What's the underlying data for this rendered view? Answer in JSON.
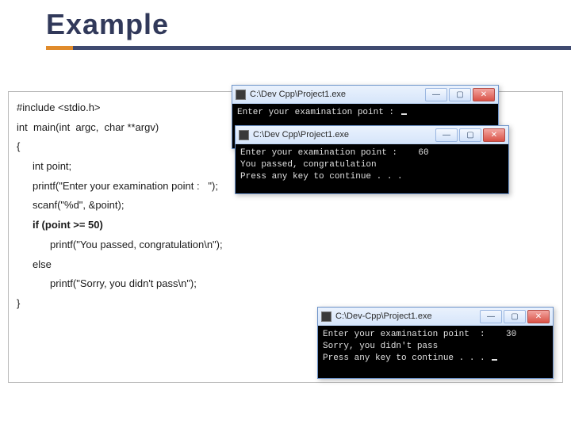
{
  "title": "Example",
  "code": {
    "l1": "#include <stdio.h>",
    "l2": "int  main(int  argc,  char **argv)",
    "l3": "{",
    "l4": "int point;",
    "l5": "printf(\"Enter your examination point :   \");",
    "l6": "scanf(\"%d\", &point);",
    "l7a": "if (",
    "l7b": "point >= 50)",
    "l8": "printf(\"You passed, congratulation\\n\");",
    "l9": "else",
    "l10": "printf(\"Sorry, you didn't pass\\n\");",
    "l11": "}"
  },
  "win1": {
    "title": "C:\\Dev Cpp\\Project1.exe",
    "line1": "Enter your examination point : "
  },
  "win2": {
    "title": "C:\\Dev Cpp\\Project1.exe",
    "line1": "Enter your examination point :    60",
    "line2": "You passed, congratulation",
    "line3": "Press any key to continue . . ."
  },
  "win3": {
    "title": "C:\\Dev-Cpp\\Project1.exe",
    "line1": "Enter your examination point  :    30",
    "line2": "Sorry, you didn't pass",
    "line3": "Press any key to continue . . . "
  },
  "btn": {
    "min": "—",
    "max": "▢",
    "close": "✕"
  }
}
